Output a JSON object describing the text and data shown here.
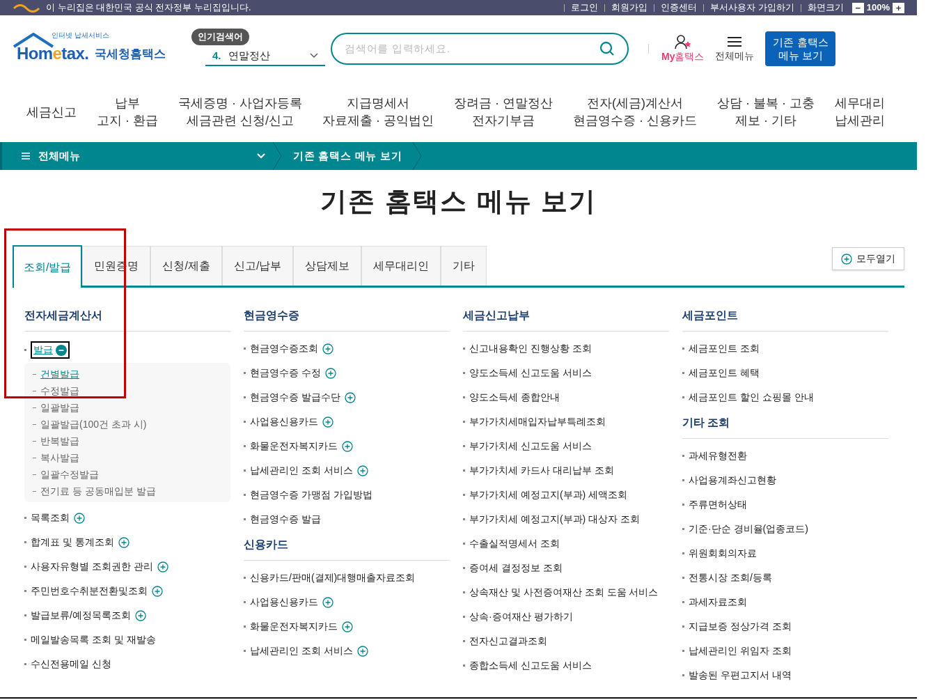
{
  "top_bar": {
    "notice": "이 누리집은 대한민국 공식 전자정부 누리집입니다.",
    "links": [
      "로그인",
      "회원가입",
      "인증센터",
      "부서사용자 가입하기"
    ],
    "zoom_label": "화면크기",
    "zoom_minus": "−",
    "zoom_value": "100%",
    "zoom_plus": "+"
  },
  "header": {
    "logo_small": "인터넷 납세서비스",
    "logo_main_a": "Hom",
    "logo_main_e": "e",
    "logo_main_b": "tax.",
    "logo_sub": "국세청홈택스",
    "popular_badge": "인기검색어",
    "popular_rank": "4.",
    "popular_term": "연말정산",
    "search_placeholder": "검색어를 입력하세요.",
    "my_label_a": "My",
    "my_label_b": "홈택스",
    "menu_label": "전체메뉴",
    "legacy_button": "기존 홈택스 메뉴 보기"
  },
  "main_nav": [
    [
      "세금신고"
    ],
    [
      "납부",
      "고지 · 환급"
    ],
    [
      "국세증명 · 사업자등록",
      "세금관련 신청/신고"
    ],
    [
      "지급명세서",
      "자료제출 · 공익법인"
    ],
    [
      "장려금 · 연말정산",
      "전자기부금"
    ],
    [
      "전자(세금)계산서",
      "현금영수증 · 신용카드"
    ],
    [
      "상담 · 불복 · 고충",
      "제보 · 기타"
    ],
    [
      "세무대리",
      "납세관리"
    ]
  ],
  "breadcrumb": {
    "menu": "전체메뉴",
    "current": "기존 홈택스 메뉴 보기"
  },
  "page_title": "기존 홈택스 메뉴 보기",
  "tabs": [
    {
      "label": "조회/발급",
      "selected": true
    },
    {
      "label": "민원증명",
      "selected": false
    },
    {
      "label": "신청/제출",
      "selected": false
    },
    {
      "label": "신고/납부",
      "selected": false
    },
    {
      "label": "상담제보",
      "selected": false
    },
    {
      "label": "세무대리인",
      "selected": false
    },
    {
      "label": "기타",
      "selected": false
    }
  ],
  "expand_all": "모두열기",
  "columns": [
    [
      {
        "title": "전자세금계산서",
        "items": [
          {
            "label": "발급",
            "kind": "expandable",
            "expanded": true,
            "children": [
              {
                "label": "건별발급",
                "selected": true
              },
              {
                "label": "수정발급",
                "selected": false
              },
              {
                "label": "일괄발급",
                "selected": false
              },
              {
                "label": "일괄발급(100건 초과 시)",
                "selected": false
              },
              {
                "label": "반복발급",
                "selected": false
              },
              {
                "label": "복사발급",
                "selected": false
              },
              {
                "label": "일괄수정발급",
                "selected": false
              },
              {
                "label": "전기료 등 공동매입분 발급",
                "selected": false
              }
            ]
          },
          {
            "label": "목록조회",
            "kind": "expandable",
            "expanded": false
          },
          {
            "label": "합계표 및 통계조회",
            "kind": "expandable",
            "expanded": false
          },
          {
            "label": "사용자유형별 조회권한 관리",
            "kind": "expandable",
            "expanded": false
          },
          {
            "label": "주민번호수취분전환및조회",
            "kind": "expandable",
            "expanded": false
          },
          {
            "label": "발급보류/예정목록조회",
            "kind": "expandable",
            "expanded": false
          },
          {
            "label": "메일발송목록 조회 및 재발송",
            "kind": "link"
          },
          {
            "label": "수신전용메일 신청",
            "kind": "link"
          }
        ]
      }
    ],
    [
      {
        "title": "현금영수증",
        "items": [
          {
            "label": "현금영수증조회",
            "kind": "expandable",
            "expanded": false
          },
          {
            "label": "현금영수증 수정",
            "kind": "expandable",
            "expanded": false
          },
          {
            "label": "현금영수증 발급수단",
            "kind": "expandable",
            "expanded": false
          },
          {
            "label": "사업용신용카드",
            "kind": "expandable",
            "expanded": false
          },
          {
            "label": "화물운전자복지카드",
            "kind": "expandable",
            "expanded": false
          },
          {
            "label": "납세관리인 조회 서비스",
            "kind": "expandable",
            "expanded": false
          },
          {
            "label": "현금영수증 가맹점 가입방법",
            "kind": "link"
          },
          {
            "label": "현금영수증 발급",
            "kind": "link"
          }
        ]
      },
      {
        "title": "신용카드",
        "items": [
          {
            "label": "신용카드/판매(결제)대행매출자료조회",
            "kind": "link"
          },
          {
            "label": "사업용신용카드",
            "kind": "expandable",
            "expanded": false
          },
          {
            "label": "화물운전자복지카드",
            "kind": "expandable",
            "expanded": false
          },
          {
            "label": "납세관리인 조회 서비스",
            "kind": "expandable",
            "expanded": false
          }
        ]
      }
    ],
    [
      {
        "title": "세금신고납부",
        "items": [
          {
            "label": "신고내용확인 진행상황 조회",
            "kind": "link"
          },
          {
            "label": "양도소득세 신고도움 서비스",
            "kind": "link"
          },
          {
            "label": "양도소득세 종합안내",
            "kind": "link"
          },
          {
            "label": "부가가치세매입자납부특례조회",
            "kind": "link"
          },
          {
            "label": "부가가치세 신고도움 서비스",
            "kind": "link"
          },
          {
            "label": "부가가치세 카드사 대리납부 조회",
            "kind": "link"
          },
          {
            "label": "부가가치세 예정고지(부과) 세액조회",
            "kind": "link"
          },
          {
            "label": "부가가치세 예정고지(부과) 대상자 조회",
            "kind": "link"
          },
          {
            "label": "수출실적명세서 조회",
            "kind": "link"
          },
          {
            "label": "증여세 결정정보 조회",
            "kind": "link"
          },
          {
            "label": "상속재산 및 사전증여재산 조회 도움 서비스",
            "kind": "link"
          },
          {
            "label": "상속·증여재산 평가하기",
            "kind": "link"
          },
          {
            "label": "전자신고결과조회",
            "kind": "link"
          },
          {
            "label": "종합소득세 신고도움 서비스",
            "kind": "link"
          }
        ]
      }
    ],
    [
      {
        "title": "세금포인트",
        "items": [
          {
            "label": "세금포인트 조회",
            "kind": "link"
          },
          {
            "label": "세금포인트 혜택",
            "kind": "link"
          },
          {
            "label": "세금포인트 할인 쇼핑몰 안내",
            "kind": "link"
          }
        ]
      },
      {
        "title": "기타 조회",
        "items": [
          {
            "label": "과세유형전환",
            "kind": "link"
          },
          {
            "label": "사업용계좌신고현황",
            "kind": "link"
          },
          {
            "label": "주류면허상태",
            "kind": "link"
          },
          {
            "label": "기준·단순 경비율(업종코드)",
            "kind": "link"
          },
          {
            "label": "위원회회의자료",
            "kind": "link"
          },
          {
            "label": "전통시장 조회/등록",
            "kind": "link"
          },
          {
            "label": "과세자료조회",
            "kind": "link"
          },
          {
            "label": "지급보증 정상가격 조회",
            "kind": "link"
          },
          {
            "label": "납세관리인 위임자 조회",
            "kind": "link"
          },
          {
            "label": "발송된 우편고지서 내역",
            "kind": "link"
          }
        ]
      }
    ]
  ]
}
